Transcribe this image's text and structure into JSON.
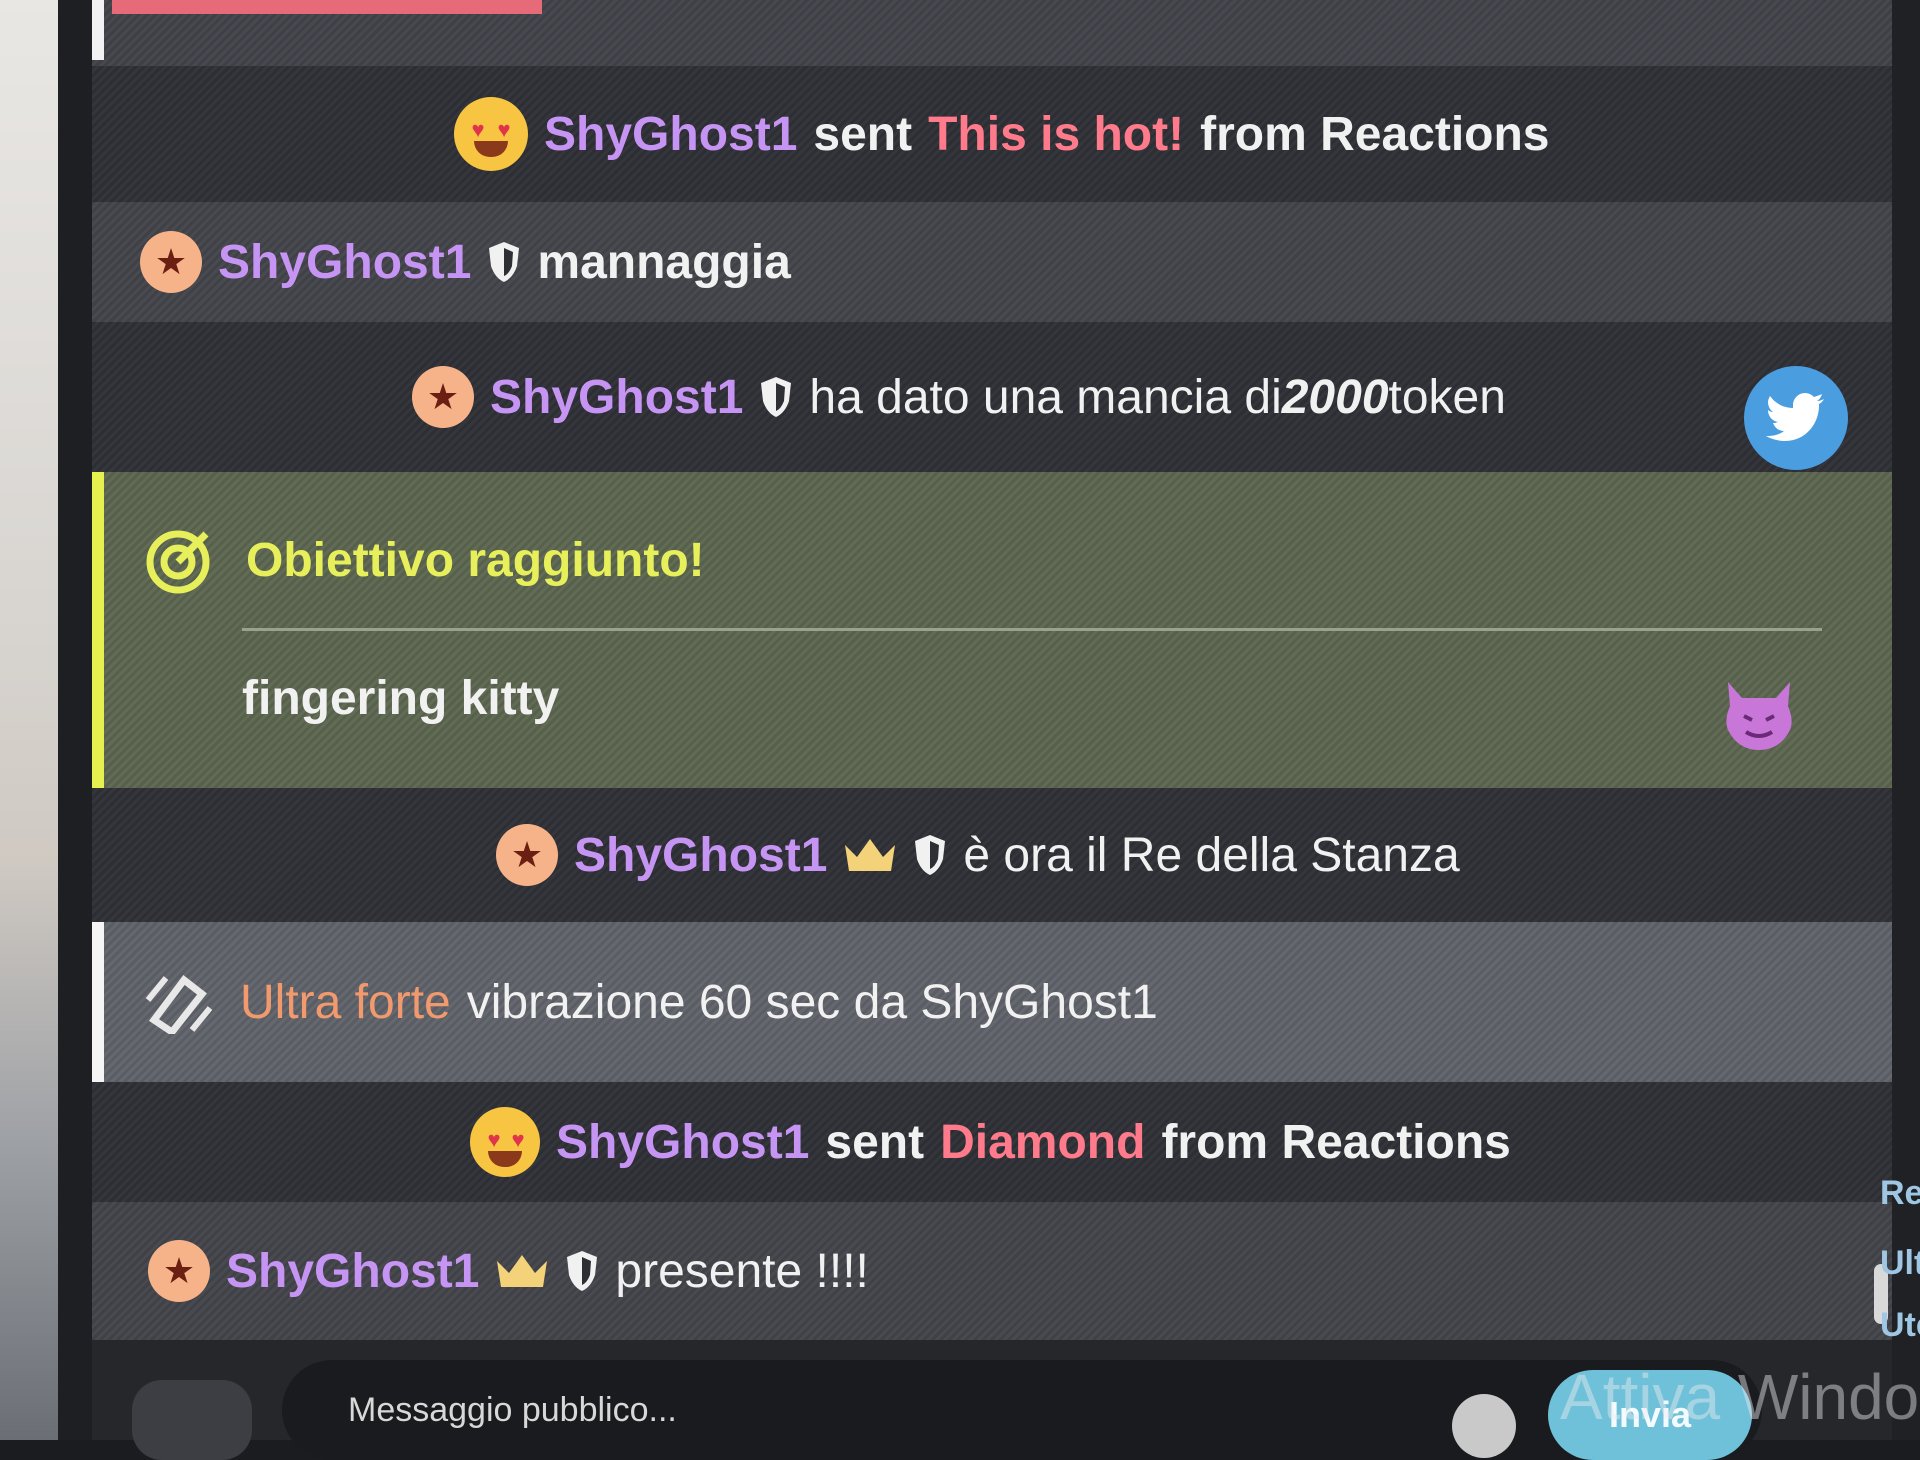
{
  "colors": {
    "username": "#c694f2",
    "gift": "#ff7a8a",
    "goal": "#e7f05a",
    "ultra": "#f29a6e",
    "twitter": "#4a9ee0",
    "send": "#6fc1d9"
  },
  "messages": [
    {
      "type": "reaction",
      "icon": "heart-eyes-emoji-icon",
      "user": "ShyGhost1",
      "pre": "sent",
      "gift": "This is hot!",
      "post": "from Reactions"
    },
    {
      "type": "chat",
      "icon": "star-badge-icon",
      "user": "ShyGhost1",
      "text": "mannaggia"
    },
    {
      "type": "tip",
      "icon": "star-badge-icon",
      "user": "ShyGhost1",
      "text_a": "ha dato una mancia di ",
      "amount": "2000",
      "text_b": " token"
    },
    {
      "type": "goal",
      "icon": "target-icon",
      "title": "Obiettivo raggiunto!",
      "body": "fingering kitty"
    },
    {
      "type": "king",
      "icon": "star-badge-icon",
      "user": "ShyGhost1",
      "text": "è ora il Re della Stanza"
    },
    {
      "type": "vibe",
      "icon": "vibration-icon",
      "level": "Ultra forte",
      "text": "vibrazione 60 sec da ShyGhost1"
    },
    {
      "type": "reaction",
      "icon": "heart-eyes-emoji-icon",
      "user": "ShyGhost1",
      "pre": "sent",
      "gift": "Diamond",
      "post": "from Reactions"
    },
    {
      "type": "chat",
      "icon": "star-badge-icon",
      "user": "ShyGhost1",
      "text": "presente !!!!"
    }
  ],
  "input": {
    "placeholder": "Messaggio pubblico...",
    "send_label": "Invia"
  },
  "side_labels": [
    "Re",
    "Ult",
    "Ute"
  ],
  "watermark": "Attiva Windo"
}
